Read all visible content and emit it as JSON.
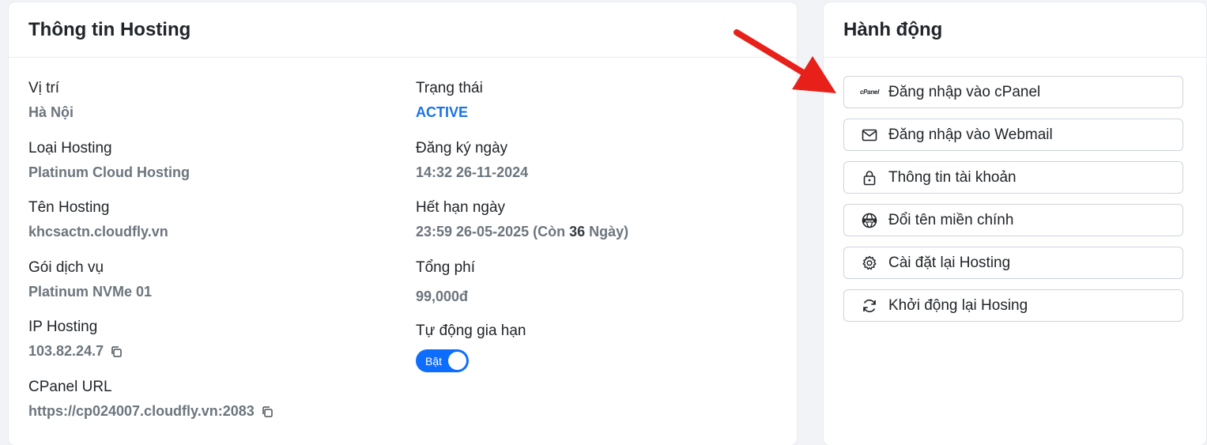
{
  "info": {
    "title": "Thông tin Hosting",
    "location_label": "Vị trí",
    "location_value": "Hà Nội",
    "type_label": "Loại Hosting",
    "type_value": "Platinum Cloud Hosting",
    "name_label": "Tên Hosting",
    "name_value": "khcsactn.cloudfly.vn",
    "plan_label": "Gói dịch vụ",
    "plan_value": "Platinum NVMe 01",
    "ip_label": "IP Hosting",
    "ip_value": "103.82.24.7",
    "cpanel_url_label": "CPanel URL",
    "cpanel_url_value": "https://cp024007.cloudfly.vn:2083",
    "status_label": "Trạng thái",
    "status_value": "ACTIVE",
    "registered_label": "Đăng ký ngày",
    "registered_value": "14:32 26-11-2024",
    "expiry_label": "Hết hạn ngày",
    "expiry_date": "23:59 26-05-2025 (Còn ",
    "expiry_days": "36",
    "expiry_suffix": " Ngày)",
    "total_label": "Tổng phí",
    "total_value": "99,000đ",
    "autorenew_label": "Tự động gia hạn",
    "autorenew_toggle": "Bật"
  },
  "actions": {
    "title": "Hành động",
    "buttons": [
      {
        "label": "Đăng nhập vào cPanel",
        "icon": "cpanel-icon",
        "icon_text": "cPanel"
      },
      {
        "label": "Đăng nhập vào Webmail",
        "icon": "envelope-icon"
      },
      {
        "label": "Thông tin tài khoản",
        "icon": "lock-icon"
      },
      {
        "label": "Đổi tên miền chính",
        "icon": "globe-www-icon"
      },
      {
        "label": "Cài đặt lại Hosting",
        "icon": "gear-icon"
      },
      {
        "label": "Khởi động lại Hosing",
        "icon": "refresh-icon"
      }
    ]
  },
  "colors": {
    "accent": "#0d6efd",
    "status_active": "#1a73e8",
    "arrow": "#e8201a"
  }
}
